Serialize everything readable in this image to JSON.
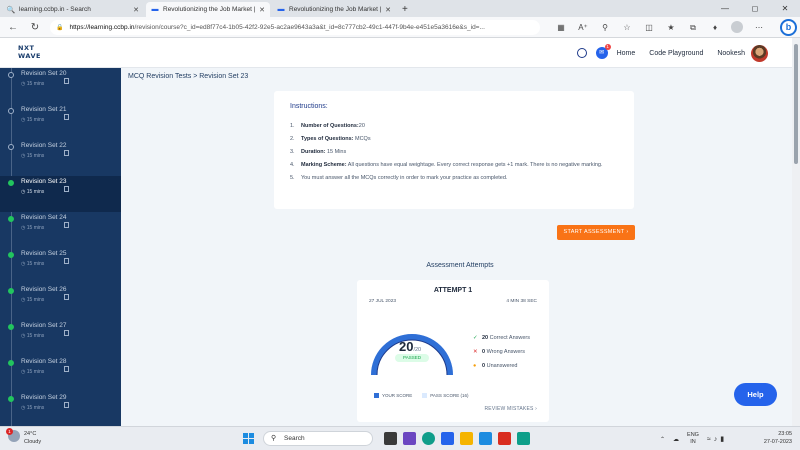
{
  "browser": {
    "tabs": [
      {
        "title": "learning.ccbp.in - Search",
        "active": false
      },
      {
        "title": "Revolutionizing the Job Market |",
        "active": true
      },
      {
        "title": "Revolutionizing the Job Market |",
        "active": false
      }
    ],
    "url_host": "https://learning.ccbp.in",
    "url_path": "/revision/course?c_id=ed8f77c4-1b05-42f2-92e5-ac2ae9643a3a&t_id=8c777cb2-49c1-447f-9b4e-e451e5a3616e&s_id=..."
  },
  "header": {
    "logo_line1": "NXT",
    "logo_line2": "WAVE",
    "notification_count": "1",
    "nav_home": "Home",
    "nav_playground": "Code Playground",
    "user_name": "Nookesh"
  },
  "sidebar": {
    "items": [
      {
        "name": "Revision Set 20",
        "duration": "15 mins",
        "done": false,
        "active": false
      },
      {
        "name": "Revision Set 21",
        "duration": "15 mins",
        "done": false,
        "active": false
      },
      {
        "name": "Revision Set 22",
        "duration": "15 mins",
        "done": false,
        "active": false
      },
      {
        "name": "Revision Set 23",
        "duration": "15 mins",
        "done": true,
        "active": true
      },
      {
        "name": "Revision Set 24",
        "duration": "15 mins",
        "done": true,
        "active": false
      },
      {
        "name": "Revision Set 25",
        "duration": "15 mins",
        "done": true,
        "active": false
      },
      {
        "name": "Revision Set 26",
        "duration": "15 mins",
        "done": true,
        "active": false
      },
      {
        "name": "Revision Set 27",
        "duration": "15 mins",
        "done": true,
        "active": false
      },
      {
        "name": "Revision Set 28",
        "duration": "15 mins",
        "done": true,
        "active": false
      },
      {
        "name": "Revision Set 29",
        "duration": "15 mins",
        "done": true,
        "active": false
      }
    ]
  },
  "main": {
    "breadcrumb": "MCQ Revision Tests > Revision Set 23",
    "instructions_title": "Instructions:",
    "instructions": [
      {
        "num": "1.",
        "key": "Number of Questions:",
        "value": "20"
      },
      {
        "num": "2.",
        "key": "Types of Questions:",
        "value": " MCQs"
      },
      {
        "num": "3.",
        "key": "Duration:",
        "value": "  15 Mins"
      },
      {
        "num": "4.",
        "key": "Marking Scheme:",
        "value": " All questions have equal weightage. Every correct response gets +1 mark. There is no negative marking."
      },
      {
        "num": "5.",
        "key": "",
        "value": "You must answer all the MCQs correctly in order to mark your practice as completed."
      }
    ],
    "start_button": "START ASSESSMENT",
    "attempts_title": "Assessment Attempts",
    "attempt": {
      "title": "ATTEMPT 1",
      "date": "27 JUL 2023",
      "duration": "4 MIN 38 SEC",
      "score": "20",
      "total": "/20",
      "status": "PASSED",
      "score_fraction": 1.0,
      "pass_fraction": 0.8,
      "correct_count": "20",
      "correct_label": "Correct Answers",
      "wrong_count": "0",
      "wrong_label": "Wrong Answers",
      "unanswered_count": "0",
      "unanswered_label": "Unanswered",
      "legend_your": "YOUR SCORE",
      "legend_pass": "PASS SCORE (16)",
      "review": "REVIEW MISTAKES"
    },
    "help": "Help"
  },
  "colors": {
    "sidebar_bg": "#183863",
    "accent_orange": "#f97316",
    "accent_blue": "#2563eb",
    "pass_green": "#16a34a"
  },
  "taskbar": {
    "weather_temp": "24°C",
    "weather_desc": "Cloudy",
    "weather_badge": "1",
    "search_placeholder": "Search",
    "lang_line1": "ENG",
    "lang_line2": "IN",
    "time": "23:05",
    "date": "27-07-2023"
  }
}
